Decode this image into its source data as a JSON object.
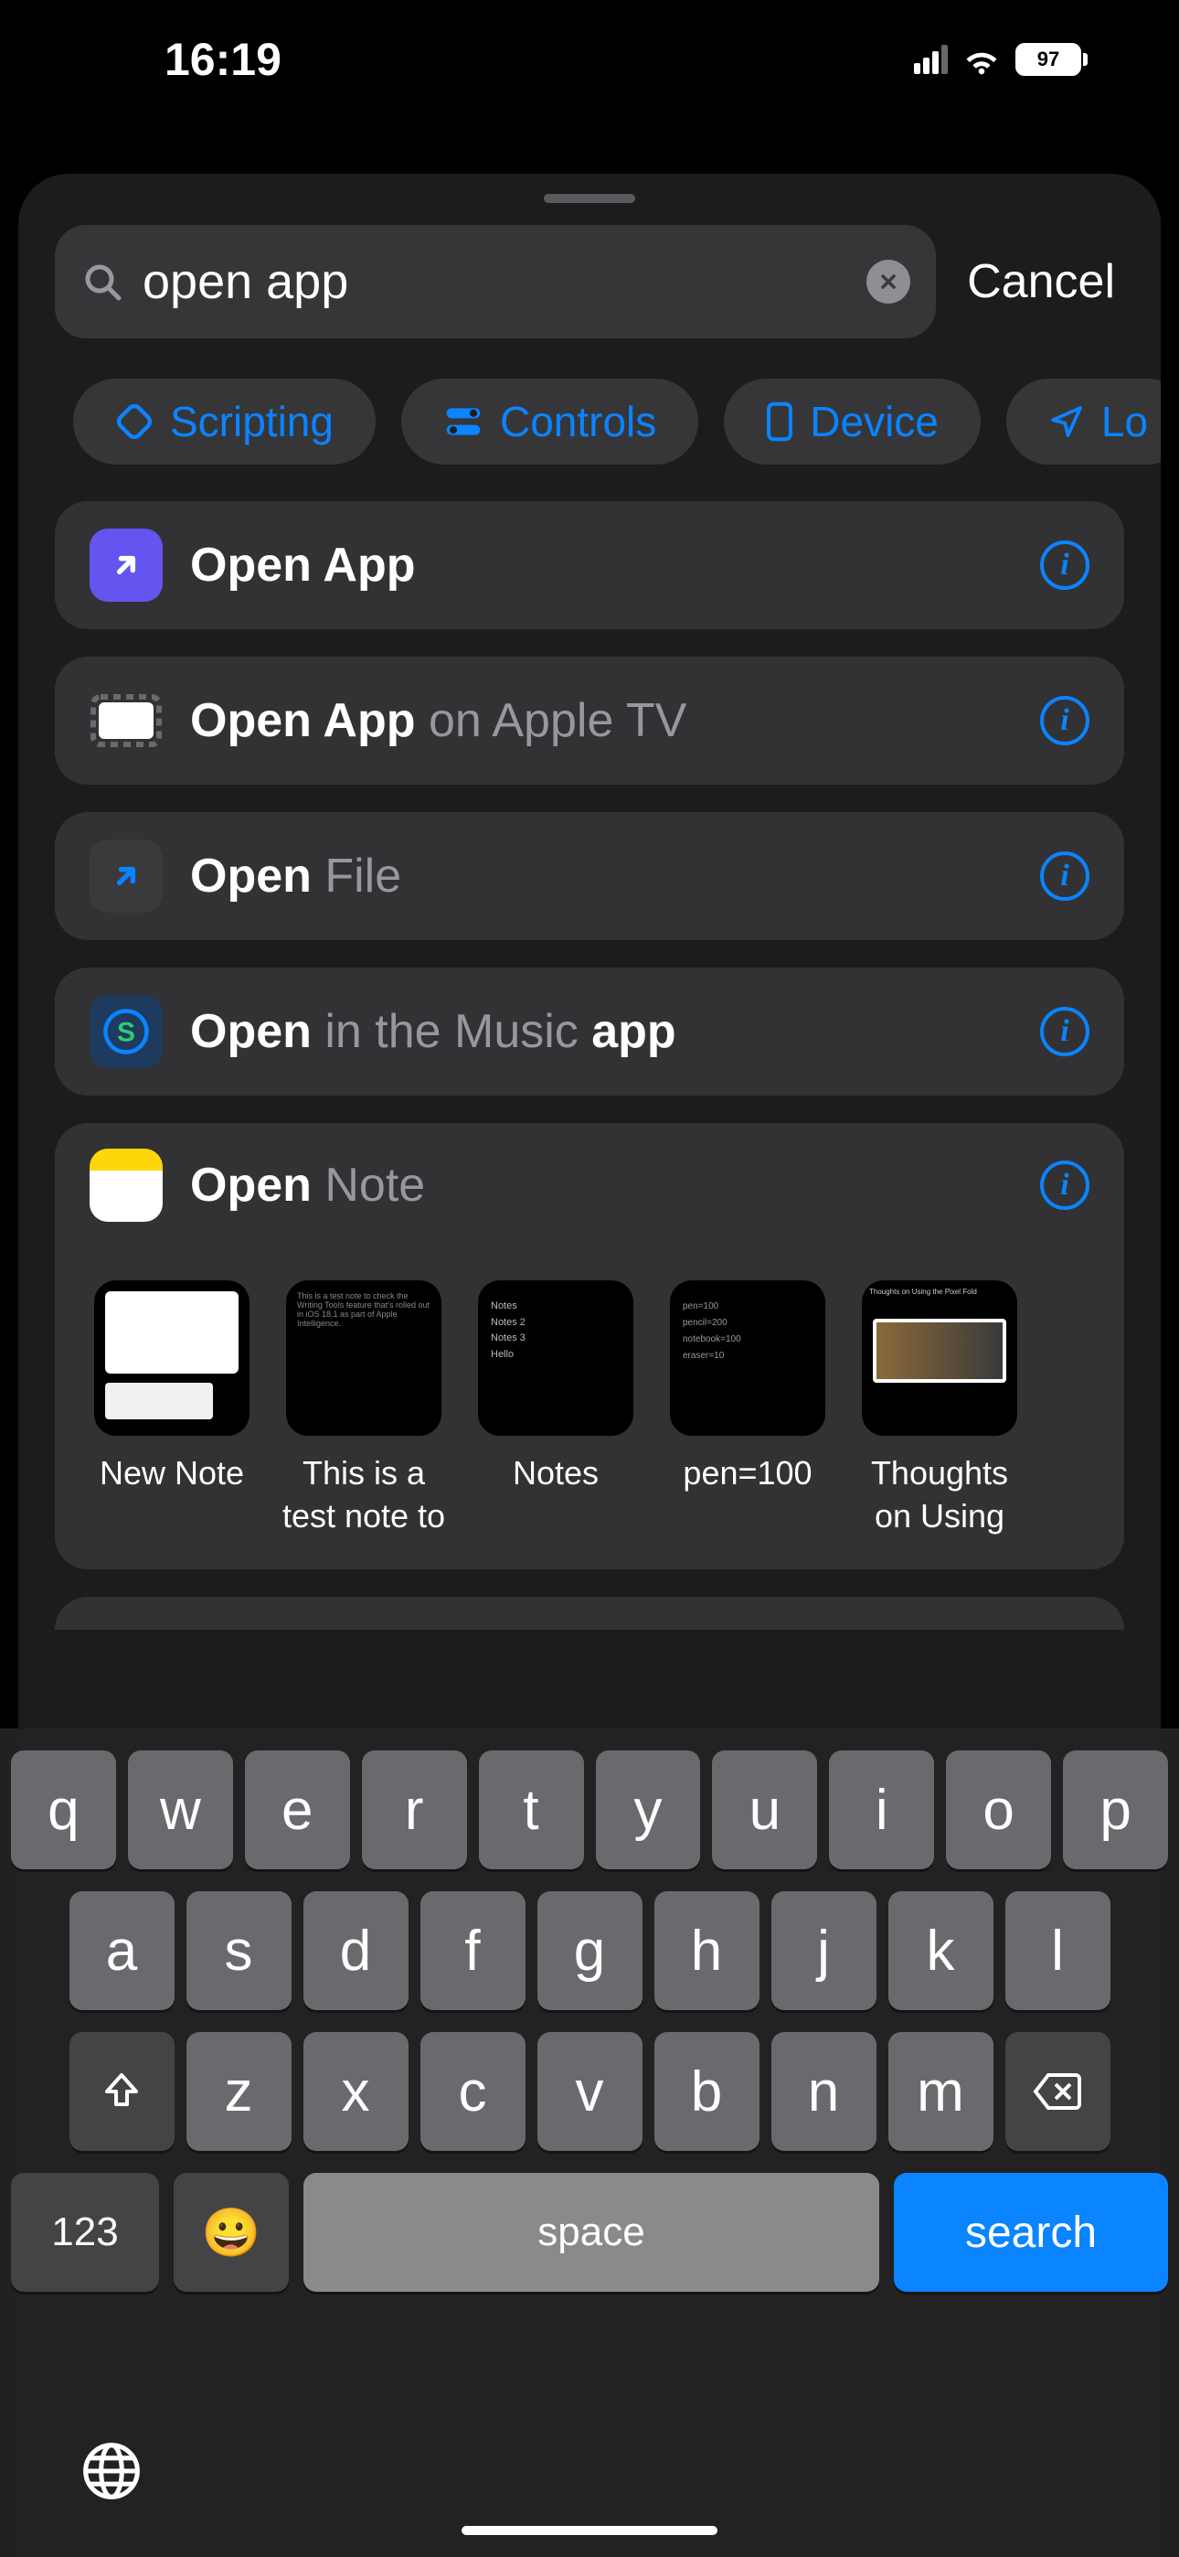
{
  "status": {
    "time": "16:19",
    "battery": "97"
  },
  "search": {
    "query": "open app",
    "cancel_label": "Cancel"
  },
  "chips": [
    {
      "id": "scripting",
      "label": "Scripting"
    },
    {
      "id": "controls",
      "label": "Controls"
    },
    {
      "id": "device",
      "label": "Device"
    },
    {
      "id": "location",
      "label": "Lo"
    }
  ],
  "results": [
    {
      "id": "open-app",
      "title_bold": "Open App",
      "title_dim": "",
      "icon": "open-app"
    },
    {
      "id": "open-apple-tv",
      "title_bold": "Open App",
      "title_dim": " on Apple TV",
      "icon": "apple-tv"
    },
    {
      "id": "open-file",
      "title_bold": "Open",
      "title_dim": " File",
      "icon": "open-file"
    },
    {
      "id": "open-music",
      "title_bold_a": "Open",
      "title_dim_a": " in the Music ",
      "title_bold_b": "app",
      "icon": "music"
    }
  ],
  "notes": {
    "title_bold": "Open",
    "title_dim": " Note",
    "cards": [
      {
        "label": "New Note"
      },
      {
        "label": "This is a test note to ch..."
      },
      {
        "label": "Notes"
      },
      {
        "label": "pen=100"
      },
      {
        "label": "Thoughts on Using the..."
      }
    ],
    "thumb2_lines": "Notes\nNotes 2\nNotes 3\nHello",
    "thumb4_title": "Thoughts on Using the Pixel Fold"
  },
  "keyboard": {
    "row1": [
      "q",
      "w",
      "e",
      "r",
      "t",
      "y",
      "u",
      "i",
      "o",
      "p"
    ],
    "row2": [
      "a",
      "s",
      "d",
      "f",
      "g",
      "h",
      "j",
      "k",
      "l"
    ],
    "row3": [
      "z",
      "x",
      "c",
      "v",
      "b",
      "n",
      "m"
    ],
    "numbers_label": "123",
    "space_label": "space",
    "search_label": "search"
  }
}
